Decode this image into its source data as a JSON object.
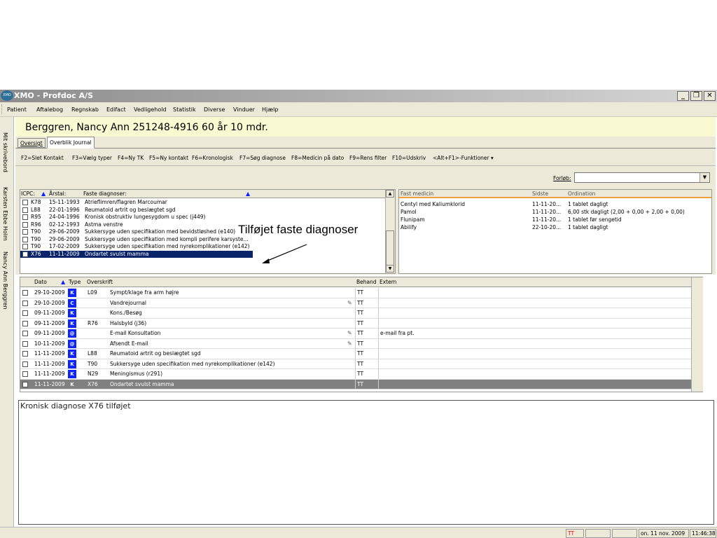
{
  "window": {
    "title": "XMO - Profdoc A/S",
    "icon": "XMO",
    "min": "_",
    "restore": "❐",
    "close": "✕"
  },
  "menu": [
    "Patient",
    "Aftalebog",
    "Regnskab",
    "Edifact",
    "Vedligehold",
    "Statistik",
    "Diverse",
    "Vinduer",
    "Hjælp"
  ],
  "side_tabs": [
    "Mit skrivebord",
    "Karsten Ebbe Holm",
    "Nancy Ann Berggren"
  ],
  "patient_header": "Berggren, Nancy Ann 251248-4916    60 år 10 mdr.",
  "tabs": [
    "Oversigt",
    "Overblik Journal"
  ],
  "fkeys": [
    "F2=Slet Kontakt",
    "F3=Vælg typer",
    "F4=Ny TK",
    "F5=Ny kontakt",
    "F6=Kronologisk",
    "F7=Søg diagnose",
    "F8=Medicin på dato",
    "F9=Rens filter",
    "F10=Udskriv",
    "<Alt+F1>-Funktioner ▾"
  ],
  "forlob_label": "Forløb:",
  "diag_headers": {
    "icpc": "ICPC:",
    "year": "Årstal:",
    "diag": "Faste diagnoser:"
  },
  "diagnoses": [
    {
      "code": "K78",
      "date": "15-11-1993",
      "text": "Atrieflimren/flagren Marcoumar"
    },
    {
      "code": "L88",
      "date": "22-01-1996",
      "text": "Reumatoid artrit og beslægtet sgd"
    },
    {
      "code": "R95",
      "date": "24-04-1996",
      "text": "Kronisk obstruktiv lungesygdom u spec (j449)"
    },
    {
      "code": "R96",
      "date": "02-12-1993",
      "text": "Astma venstre"
    },
    {
      "code": "T90",
      "date": "29-06-2009",
      "text": "Sukkersyge uden specifikation med bevidstløshed (e140)"
    },
    {
      "code": "T90",
      "date": "29-06-2009",
      "text": "Sukkersyge uden specifikation med kompli perifere karsyste..."
    },
    {
      "code": "T90",
      "date": "17-02-2009",
      "text": "Sukkersyge uden specifikation med nyrekomplikationer (e142)"
    },
    {
      "code": "X76",
      "date": "11-11-2009",
      "text": "Ondartet svulst mamma"
    }
  ],
  "med_headers": {
    "name": "Fast medicin",
    "last": "Sidste",
    "ord": "Ordination"
  },
  "medicines": [
    {
      "name": "Centyl med Kaliumklorid",
      "last": "11-11-20...",
      "ord": "1 tablet dagligt"
    },
    {
      "name": "Pamol",
      "last": "11-11-20...",
      "ord": "6,00 stk dagligt (2,00 + 0,00 + 2,00 + 0,00)"
    },
    {
      "name": "Flunipam",
      "last": "11-11-20...",
      "ord": "1 tablet før sengetid"
    },
    {
      "name": "Abilify",
      "last": "22-10-20...",
      "ord": "1 tablet dagligt"
    }
  ],
  "journal_headers": {
    "date": "Dato",
    "type": "Type",
    "title": "Overskrift",
    "behand": "Behand",
    "extern": "Extern"
  },
  "journal": [
    {
      "date": "29-10-2009",
      "type": "K",
      "code": "L09",
      "text": "Sympt/klage fra arm højre",
      "pen": false,
      "behand": "TT",
      "extern": ""
    },
    {
      "date": "29-10-2009",
      "type": "C",
      "code": "",
      "text": "Vandrejournal",
      "pen": true,
      "behand": "TT",
      "extern": ""
    },
    {
      "date": "09-11-2009",
      "type": "K",
      "code": "",
      "text": "Kons./Besøg",
      "pen": false,
      "behand": "TT",
      "extern": ""
    },
    {
      "date": "09-11-2009",
      "type": "K",
      "code": "R76",
      "text": "Halsbyld (j36)",
      "pen": false,
      "behand": "TT",
      "extern": ""
    },
    {
      "date": "09-11-2009",
      "type": "@",
      "code": "",
      "text": "E-mail Konsultation",
      "pen": true,
      "behand": "TT",
      "extern": "e-mail fra pt."
    },
    {
      "date": "10-11-2009",
      "type": "@",
      "code": "",
      "text": "Afsendt E-mail",
      "pen": true,
      "behand": "TT",
      "extern": ""
    },
    {
      "date": "11-11-2009",
      "type": "K",
      "code": "L88",
      "text": "Reumatoid artrit og beslægtet sgd",
      "pen": false,
      "behand": "TT",
      "extern": ""
    },
    {
      "date": "11-11-2009",
      "type": "K",
      "code": "T90",
      "text": "Sukkersyge uden specifikation med nyrekomplikationer (e142)",
      "pen": false,
      "behand": "TT",
      "extern": ""
    },
    {
      "date": "11-11-2009",
      "type": "K",
      "code": "N29",
      "text": "Meningismus (r291)",
      "pen": false,
      "behand": "TT",
      "extern": ""
    },
    {
      "date": "11-11-2009",
      "type": "K",
      "code": "X76",
      "text": "Ondartet svulst mamma",
      "pen": false,
      "behand": "TT",
      "extern": ""
    }
  ],
  "callout": "Tilføjet faste diagnoser",
  "notes_text": "Kronisk diagnose X76 tilføjet",
  "status": {
    "user": "TT",
    "date": "on. 11 nov. 2009",
    "time": "11:46:38"
  },
  "colors": {
    "selection": "#0a246a",
    "type_badge": "#0d23ff",
    "highlight_row": "#808080",
    "status_user": "#ff0000"
  }
}
